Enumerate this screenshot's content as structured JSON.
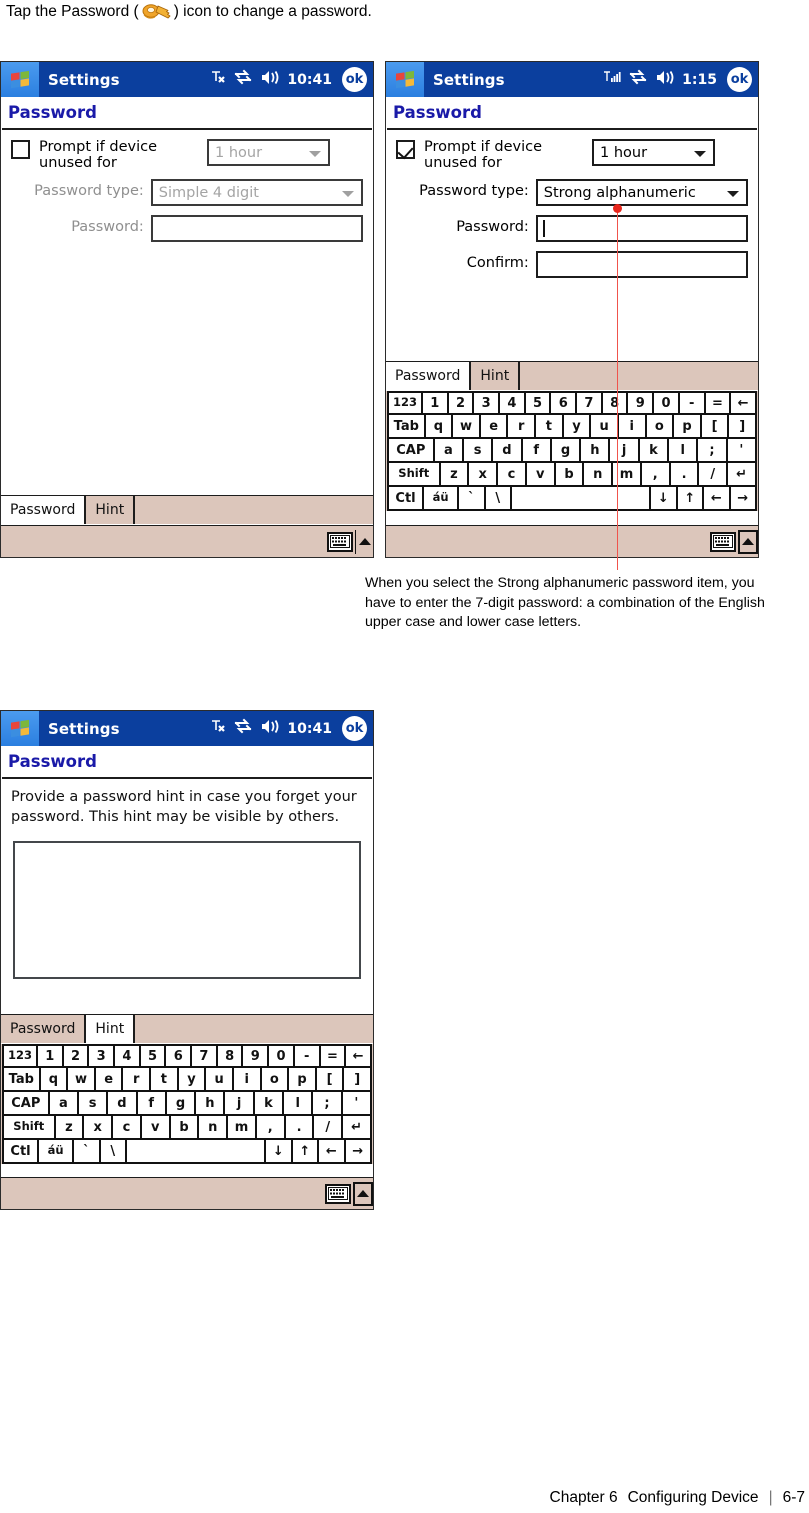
{
  "instruction": {
    "before": "Tap the Password (",
    "icon": "key-icon",
    "after": ") icon to change a password."
  },
  "screens": [
    {
      "id": "screen-password-disabled",
      "titlebar": {
        "start_icon": "windows-start-icon",
        "title": "Settings",
        "signal_icon": "no-signal-icon",
        "connectivity_icon": "connectivity-icon",
        "volume_icon": "volume-icon",
        "time": "10:41",
        "ok_label": "ok"
      },
      "heading": "Password",
      "form": {
        "prompt_checkbox_checked": false,
        "prompt_label": "Prompt if device unused for",
        "timeout_value": "1 hour",
        "password_type_label": "Password type:",
        "password_type_value": "Simple 4 digit",
        "password_label": "Password:",
        "password_value": "",
        "confirm_label": "",
        "confirm_value": "",
        "show_confirm": false,
        "disabled": true
      },
      "tabs": [
        {
          "label": "Password",
          "active": true
        },
        {
          "label": "Hint",
          "active": false
        }
      ],
      "sip": {
        "keyboard_icon": "soft-keyboard-icon",
        "arrow_icon": "sip-up-arrow-icon"
      },
      "keyboard_visible": false
    },
    {
      "id": "screen-password-strong",
      "titlebar": {
        "start_icon": "windows-start-icon",
        "title": "Settings",
        "signal_icon": "signal-bars-icon",
        "connectivity_icon": "connectivity-icon",
        "volume_icon": "volume-icon",
        "time": "1:15",
        "ok_label": "ok"
      },
      "heading": "Password",
      "form": {
        "prompt_checkbox_checked": true,
        "prompt_label": "Prompt if device unused for",
        "timeout_value": "1 hour",
        "password_type_label": "Password type:",
        "password_type_value": "Strong alphanumeric",
        "password_label": "Password:",
        "password_value": "",
        "confirm_label": "Confirm:",
        "confirm_value": "",
        "show_confirm": true,
        "disabled": false
      },
      "tabs": [
        {
          "label": "Password",
          "active": true
        },
        {
          "label": "Hint",
          "active": false
        }
      ],
      "sip": {
        "keyboard_icon": "soft-keyboard-icon",
        "arrow_icon": "sip-up-arrow-icon"
      },
      "keyboard_visible": true
    },
    {
      "id": "screen-password-hint",
      "titlebar": {
        "start_icon": "windows-start-icon",
        "title": "Settings",
        "signal_icon": "no-signal-icon",
        "connectivity_icon": "connectivity-icon",
        "volume_icon": "volume-icon",
        "time": "10:41",
        "ok_label": "ok"
      },
      "heading": "Password",
      "hint_text": "Provide a password hint in case you forget your password.  This hint may be visible by others.",
      "hint_value": "",
      "tabs": [
        {
          "label": "Password",
          "active": false
        },
        {
          "label": "Hint",
          "active": true
        }
      ],
      "sip": {
        "keyboard_icon": "soft-keyboard-icon",
        "arrow_icon": "sip-up-arrow-icon"
      },
      "keyboard_visible": true
    }
  ],
  "keyboard": {
    "rows": [
      [
        "123",
        "1",
        "2",
        "3",
        "4",
        "5",
        "6",
        "7",
        "8",
        "9",
        "0",
        "-",
        "=",
        "←"
      ],
      [
        "Tab",
        "q",
        "w",
        "e",
        "r",
        "t",
        "y",
        "u",
        "i",
        "o",
        "p",
        "[",
        "]"
      ],
      [
        "CAP",
        "a",
        "s",
        "d",
        "f",
        "g",
        "h",
        "j",
        "k",
        "l",
        ";",
        "'"
      ],
      [
        "Shift",
        "z",
        "x",
        "c",
        "v",
        "b",
        "n",
        "m",
        ",",
        ".",
        "/",
        "↵"
      ],
      [
        "Ctl",
        "áü",
        "`",
        "\\",
        "",
        "↓",
        "↑",
        "←",
        "→"
      ]
    ]
  },
  "caption": "When you select the Strong alphanumeric password item, you have to enter the 7-digit password: a combination of the English upper case and lower case letters.",
  "footer": {
    "chapter": "Chapter 6",
    "title": "Configuring Device",
    "separator": "|",
    "page": "6-7"
  },
  "colors": {
    "titlebar_blue": "#0b3f9e",
    "heading_blue": "#1a1aa8",
    "tabbar_tan": "#dcc6bb",
    "annotation_red": "#e8261c"
  }
}
